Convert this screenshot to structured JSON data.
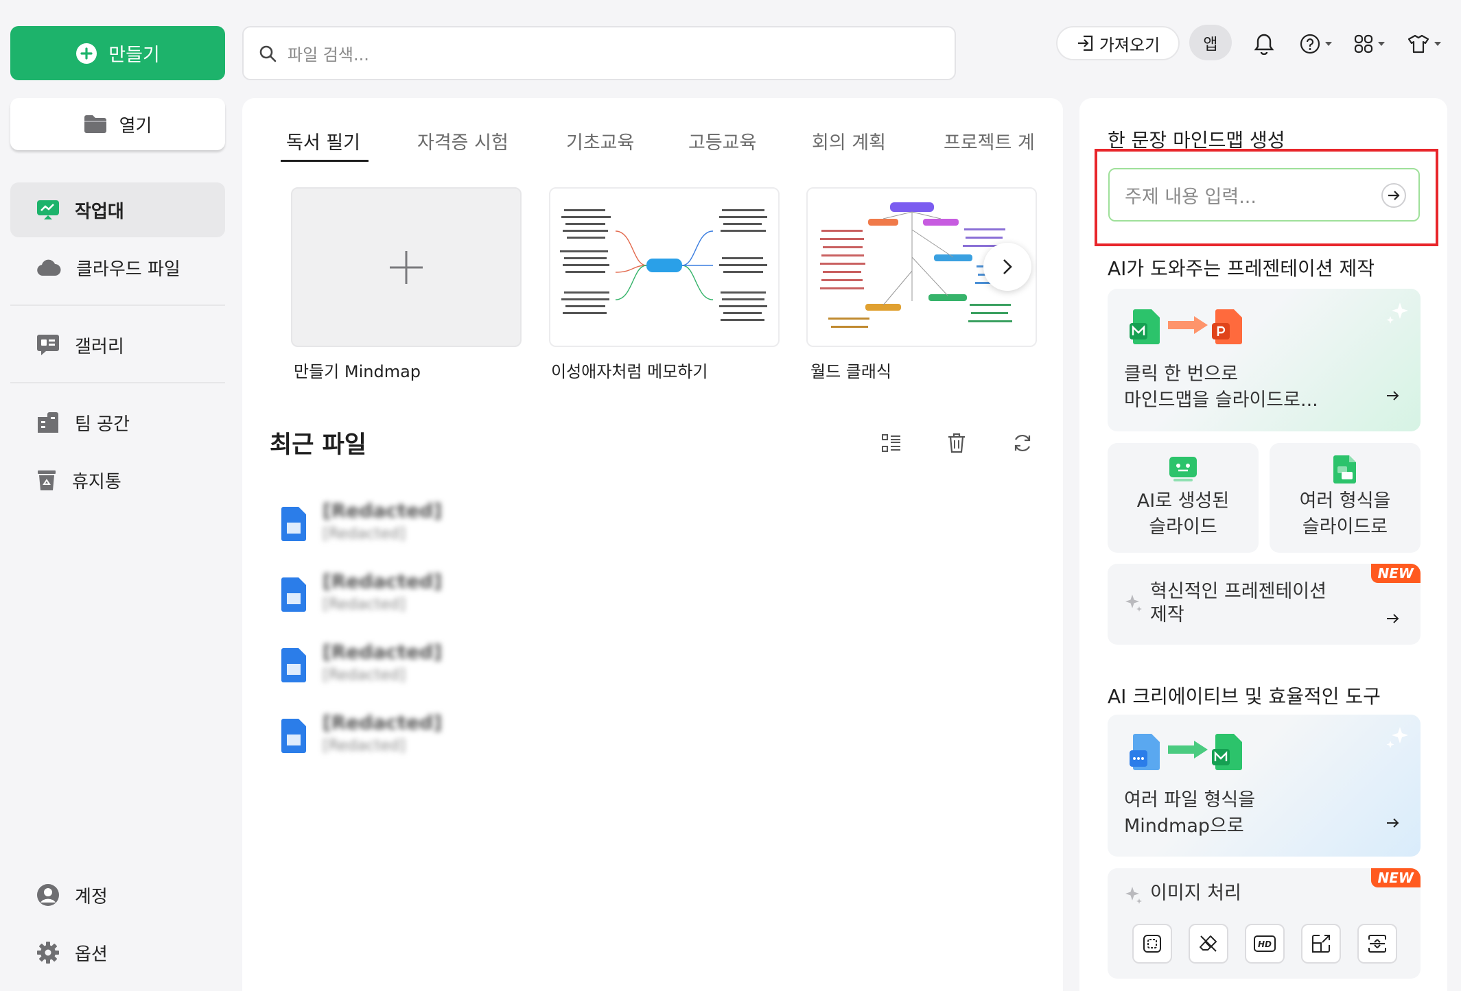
{
  "sidebar": {
    "create_label": "만들기",
    "open_label": "열기",
    "items": [
      {
        "label": "작업대",
        "icon": "workbench-icon"
      },
      {
        "label": "클라우드 파일",
        "icon": "cloud-icon"
      },
      {
        "label": "갤러리",
        "icon": "gallery-icon"
      },
      {
        "label": "팀 공간",
        "icon": "team-space-icon"
      },
      {
        "label": "휴지통",
        "icon": "trash-icon"
      }
    ],
    "account_label": "계정",
    "options_label": "옵션"
  },
  "topbar": {
    "search_placeholder": "파일 검색...",
    "import_label": "가져오기",
    "app_label": "앱"
  },
  "templates": {
    "tabs": [
      "독서 필기",
      "자격증 시험",
      "기초교육",
      "고등교육",
      "회의 계획",
      "프로젝트 계"
    ],
    "active_tab": 0,
    "cards": [
      {
        "label": "만들기 Mindmap"
      },
      {
        "label": "이성애자처럼 메모하기"
      },
      {
        "label": "월드 클래식"
      }
    ]
  },
  "recent": {
    "title": "최근 파일",
    "files": [
      {
        "title": "[Redacted]",
        "path": "[Redacted]"
      },
      {
        "title": "[Redacted]",
        "path": "[Redacted]"
      },
      {
        "title": "[Redacted]",
        "path": "[Redacted]"
      },
      {
        "title": "[Redacted]",
        "path": "[Redacted]"
      }
    ]
  },
  "right_panel": {
    "one_sentence_title": "한 문장 마인드맵 생성",
    "topic_placeholder": "주제 내용 입력...",
    "ai_presentation_title": "AI가 도와주는 프레젠테이션 제작",
    "mindmap_to_slides": {
      "line1": "클릭 한 번으로",
      "line2": "마인드맵을 슬라이드로..."
    },
    "ai_slides": {
      "line1": "AI로 생성된",
      "line2": "슬라이드"
    },
    "multi_format_slides": {
      "line1": "여러 형식을",
      "line2": "슬라이드로"
    },
    "innovative": {
      "line1": "혁신적인 프레젠테이션",
      "line2": "제작",
      "badge": "NEW"
    },
    "ai_tools_title": "AI 크리에이티브 및 효율적인 도구",
    "files_to_mindmap": {
      "line1": "여러 파일 형식을",
      "line2": "Mindmap으로"
    },
    "image_processing": {
      "label": "이미지 처리",
      "badge": "NEW"
    }
  },
  "colors": {
    "brand": "#1db36b",
    "highlight": "#e8262b",
    "badge": "#ff5a1f"
  }
}
